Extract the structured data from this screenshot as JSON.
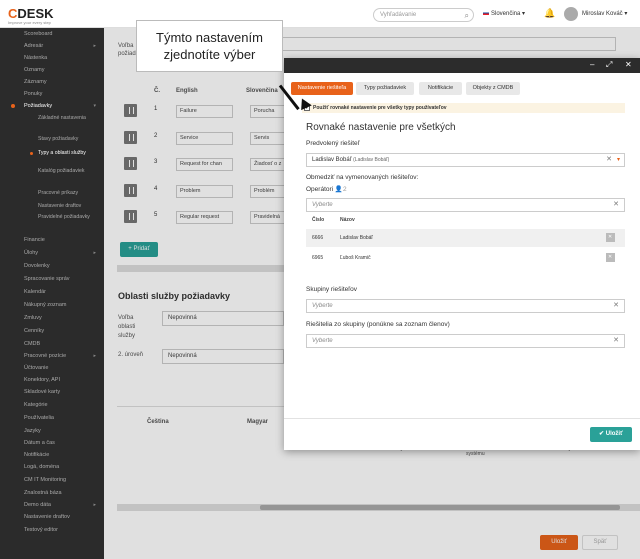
{
  "topbar": {
    "logo_c": "C",
    "logo_rest": "DESK",
    "logo_tag": "Improve your every step",
    "search_placeholder": "Vyhľadávanie",
    "language": "Slovenčina",
    "user_name": "Miroslav Kováč"
  },
  "sidebar": {
    "items": [
      {
        "label": "Scoreboard"
      },
      {
        "label": "Adresár"
      },
      {
        "label": "Nástenka"
      },
      {
        "label": "Oznamy"
      },
      {
        "label": "Záznamy"
      },
      {
        "label": "Ponuky"
      },
      {
        "label": "Požiadavky"
      },
      {
        "label": "Základné nastavenia"
      },
      {
        "label": "Stavy požiadavky"
      },
      {
        "label": "Typy a oblasti služby"
      },
      {
        "label": "Katalóg požiadaviek"
      },
      {
        "label": "Pracovné príkazy"
      },
      {
        "label": "Nastavenie draftov"
      },
      {
        "label": "Pravidelné požiadavky"
      },
      {
        "label": "Financie"
      },
      {
        "label": "Úlohy"
      },
      {
        "label": "Dovolenky"
      },
      {
        "label": "Spracovanie správ"
      },
      {
        "label": "Kalendár"
      },
      {
        "label": "Nákupný zoznam"
      },
      {
        "label": "Zmluvy"
      },
      {
        "label": "Cenníky"
      },
      {
        "label": "CMDB"
      },
      {
        "label": "Pracovné pozície"
      },
      {
        "label": "Účtovanie"
      },
      {
        "label": "Konektory, API"
      },
      {
        "label": "Skladové karty"
      },
      {
        "label": "Kategórie"
      },
      {
        "label": "Používatelia"
      },
      {
        "label": "Jazyky"
      },
      {
        "label": "Dátum a čas"
      },
      {
        "label": "Notifikácie"
      },
      {
        "label": "Logá, doména"
      },
      {
        "label": "CM IT Monitoring"
      },
      {
        "label": "Znalostná báza"
      },
      {
        "label": "Demo dáta"
      },
      {
        "label": "Nastavenie draftov"
      },
      {
        "label": "Testový editor"
      }
    ]
  },
  "background": {
    "volba_label": "Voľba požiadaviek",
    "col_c": "Č.",
    "col_english": "English",
    "col_slovencina": "Slovenčina",
    "rows": [
      {
        "num": "1",
        "en": "Failure",
        "sk": "Porucha"
      },
      {
        "num": "2",
        "en": "Service",
        "sk": "Servis"
      },
      {
        "num": "3",
        "en": "Request for chan",
        "sk": "Žiadosť o z"
      },
      {
        "num": "4",
        "en": "Problem",
        "sk": "Problém"
      },
      {
        "num": "5",
        "en": "Regular request",
        "sk": "Pravidelná"
      }
    ],
    "add_button": "+ Pridať",
    "section_title": "Oblasti služby požiadavky",
    "volba_oblasti": "Voľba oblasti služby",
    "uroven": "2. úroveň",
    "nepovinna1": "Nepovinná",
    "nepovinna2": "Nepovinná",
    "col_cestina": "Čeština",
    "col_magyar": "Magyar",
    "frag1": "systému",
    "frag2": "nastavenie systému",
    "frag3": "systému",
    "save": "Uložiť",
    "back": "Späť"
  },
  "callout": {
    "line1": "Týmto nastavením",
    "line2": "zjednotíte výber"
  },
  "modal": {
    "tabs": [
      "Nastavenie riešiteľa",
      "Typy požiadaviek",
      "Notifikácie",
      "Objekty z CMDB"
    ],
    "notice": "Použiť rovnaké nastavenie pre všetky typy používateľov",
    "title": "Rovnaké nastavenie pre všetkých",
    "default_solver_label": "Predvolený riešiteľ",
    "default_solver_value": "Ladislav Bobáľ",
    "default_solver_sub": "(Ladislav Bobáľ)",
    "restrict_label": "Obmedziť na vymenovaných riešiteľov:",
    "operators_label": "Operátori",
    "operators_count": "2",
    "select_placeholder": "Vyberte",
    "col_cislo": "Číslo",
    "col_nazov": "Názov",
    "operators": [
      {
        "id": "6666",
        "name": "Ladislav Bobáľ"
      },
      {
        "id": "6965",
        "name": "Ľuboš Kramič"
      }
    ],
    "groups_label": "Skupiny riešiteľov",
    "group_solvers_label": "Riešitelia zo skupiny (ponúkne sa zoznam členov)",
    "save": "Uložiť"
  }
}
